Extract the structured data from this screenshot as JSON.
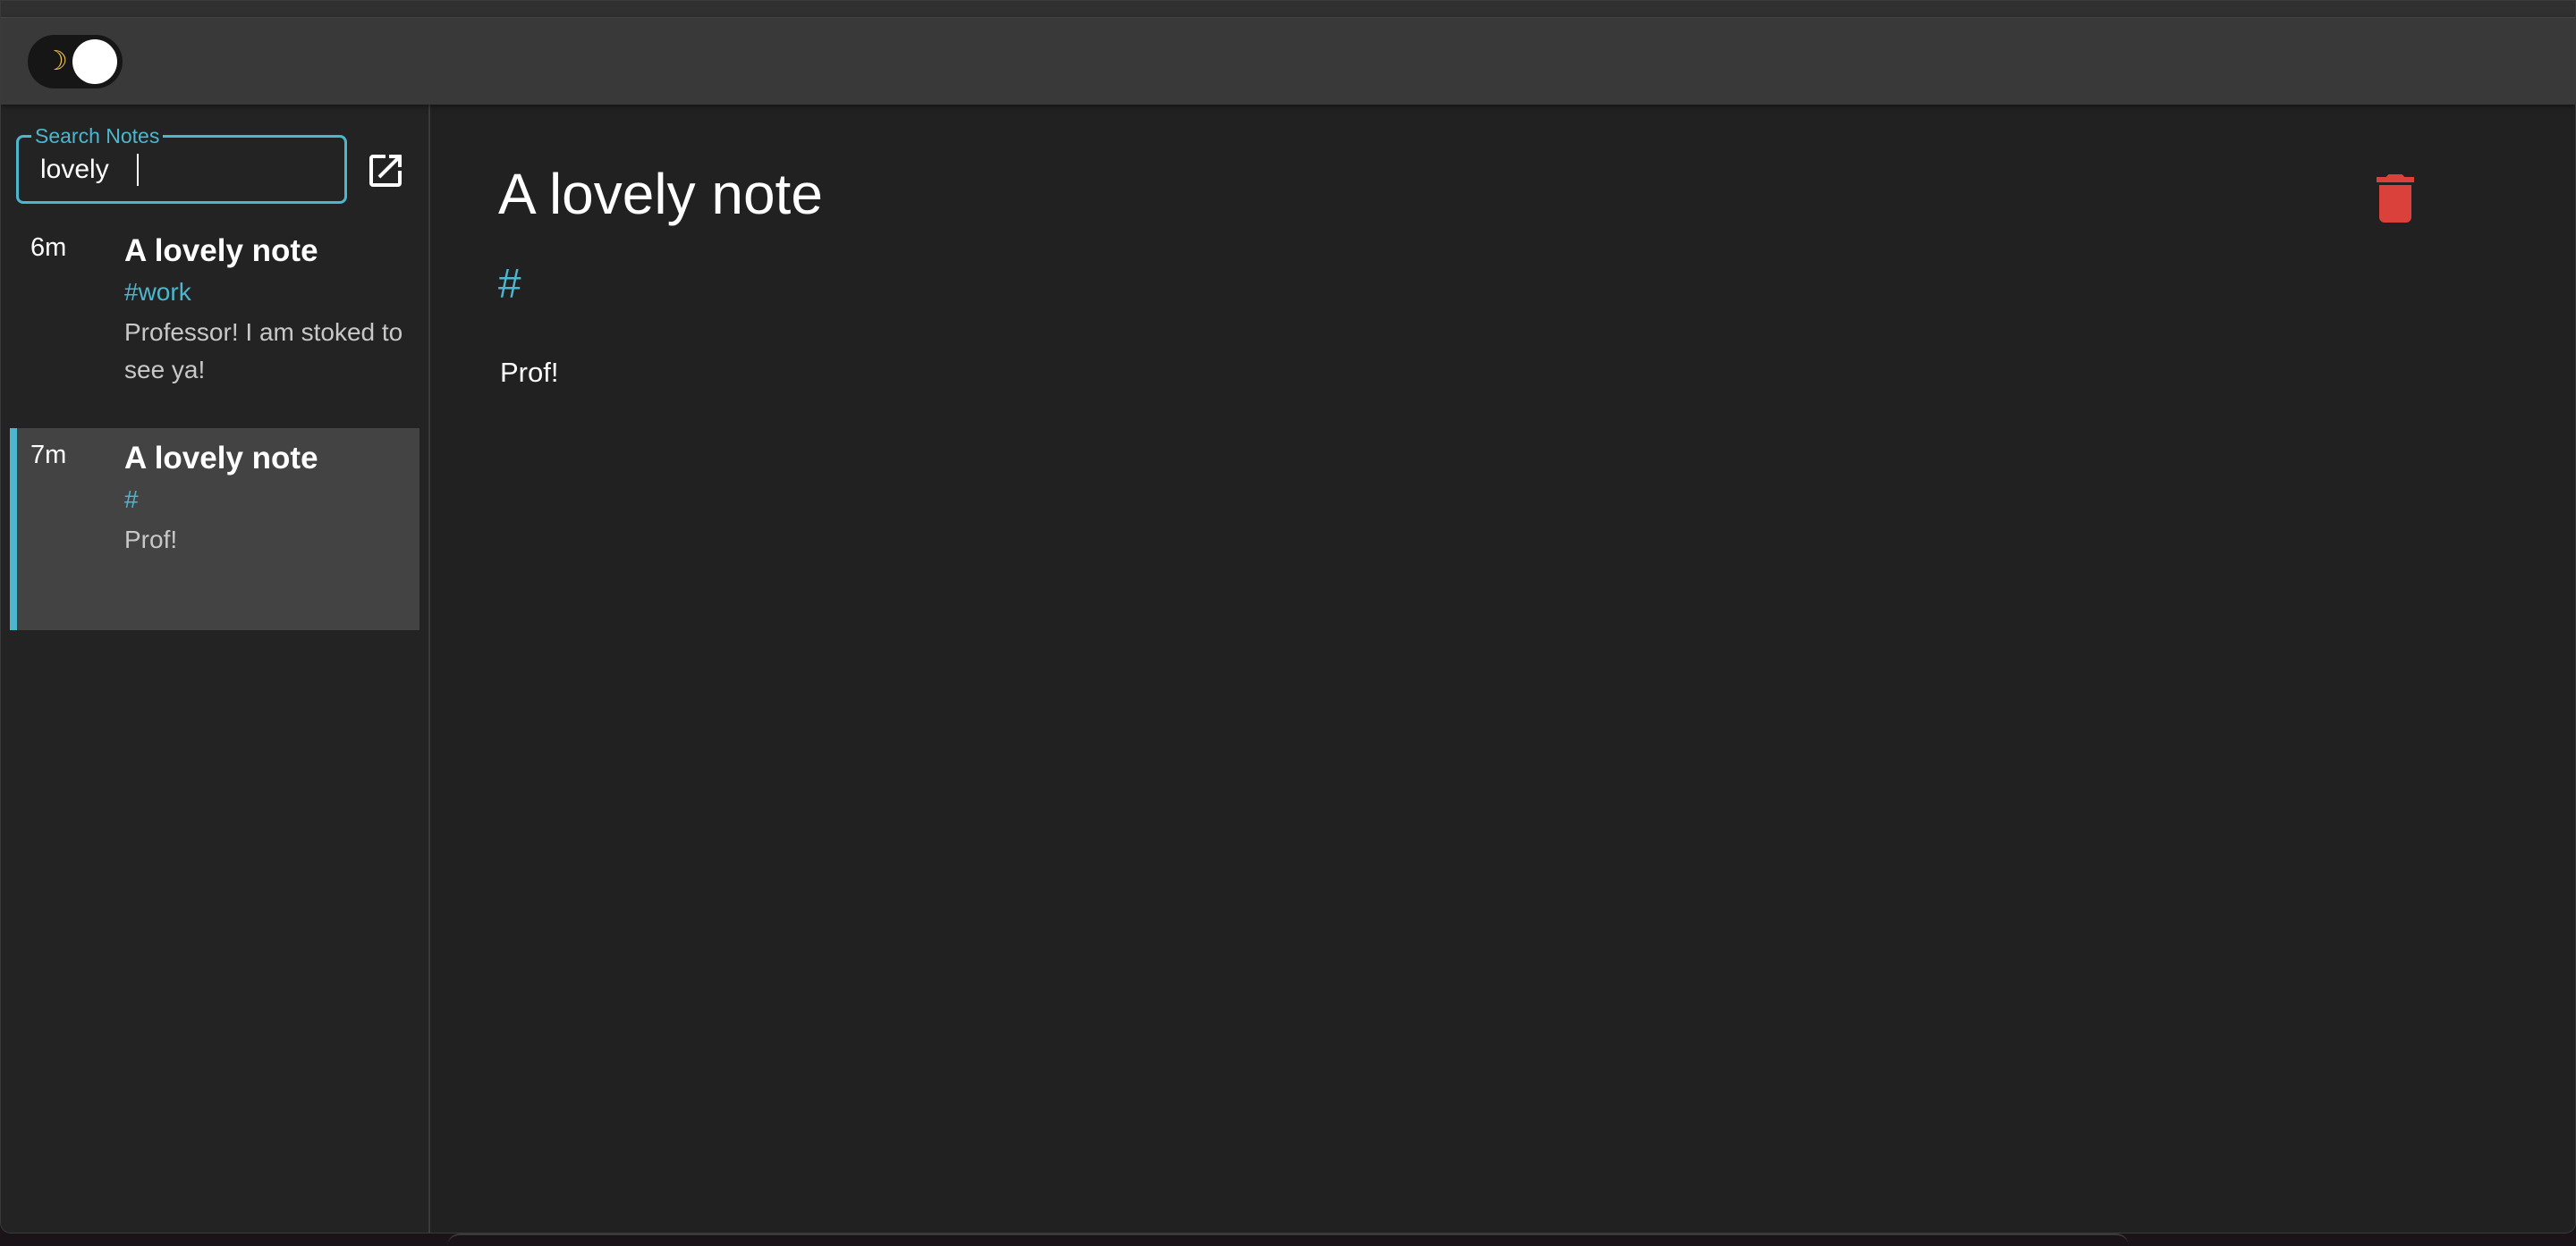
{
  "toolbar": {
    "theme_toggle": {
      "icon": "moon-icon",
      "glyph": "☽",
      "state": "dark",
      "icon_color": "#f2c94c"
    }
  },
  "sidebar": {
    "search": {
      "label": "Search Notes",
      "value": "lovely"
    },
    "open_external_icon": "open-in-new-icon",
    "notes": [
      {
        "time": "6m",
        "title": "A lovely note",
        "tag": "#work",
        "preview": "Professor! I am stoked to see ya!",
        "selected": false
      },
      {
        "time": "7m",
        "title": "A lovely note",
        "tag": "#",
        "preview": "Prof!",
        "selected": true
      }
    ]
  },
  "editor": {
    "title": "A lovely note",
    "tag": "#",
    "body": "Prof!",
    "delete_icon": "trash-icon"
  },
  "colors": {
    "accent": "#4cb6cf",
    "delete": "#d9413a",
    "background": "#212121",
    "toolbar": "#393939",
    "selected_item": "#434343"
  }
}
